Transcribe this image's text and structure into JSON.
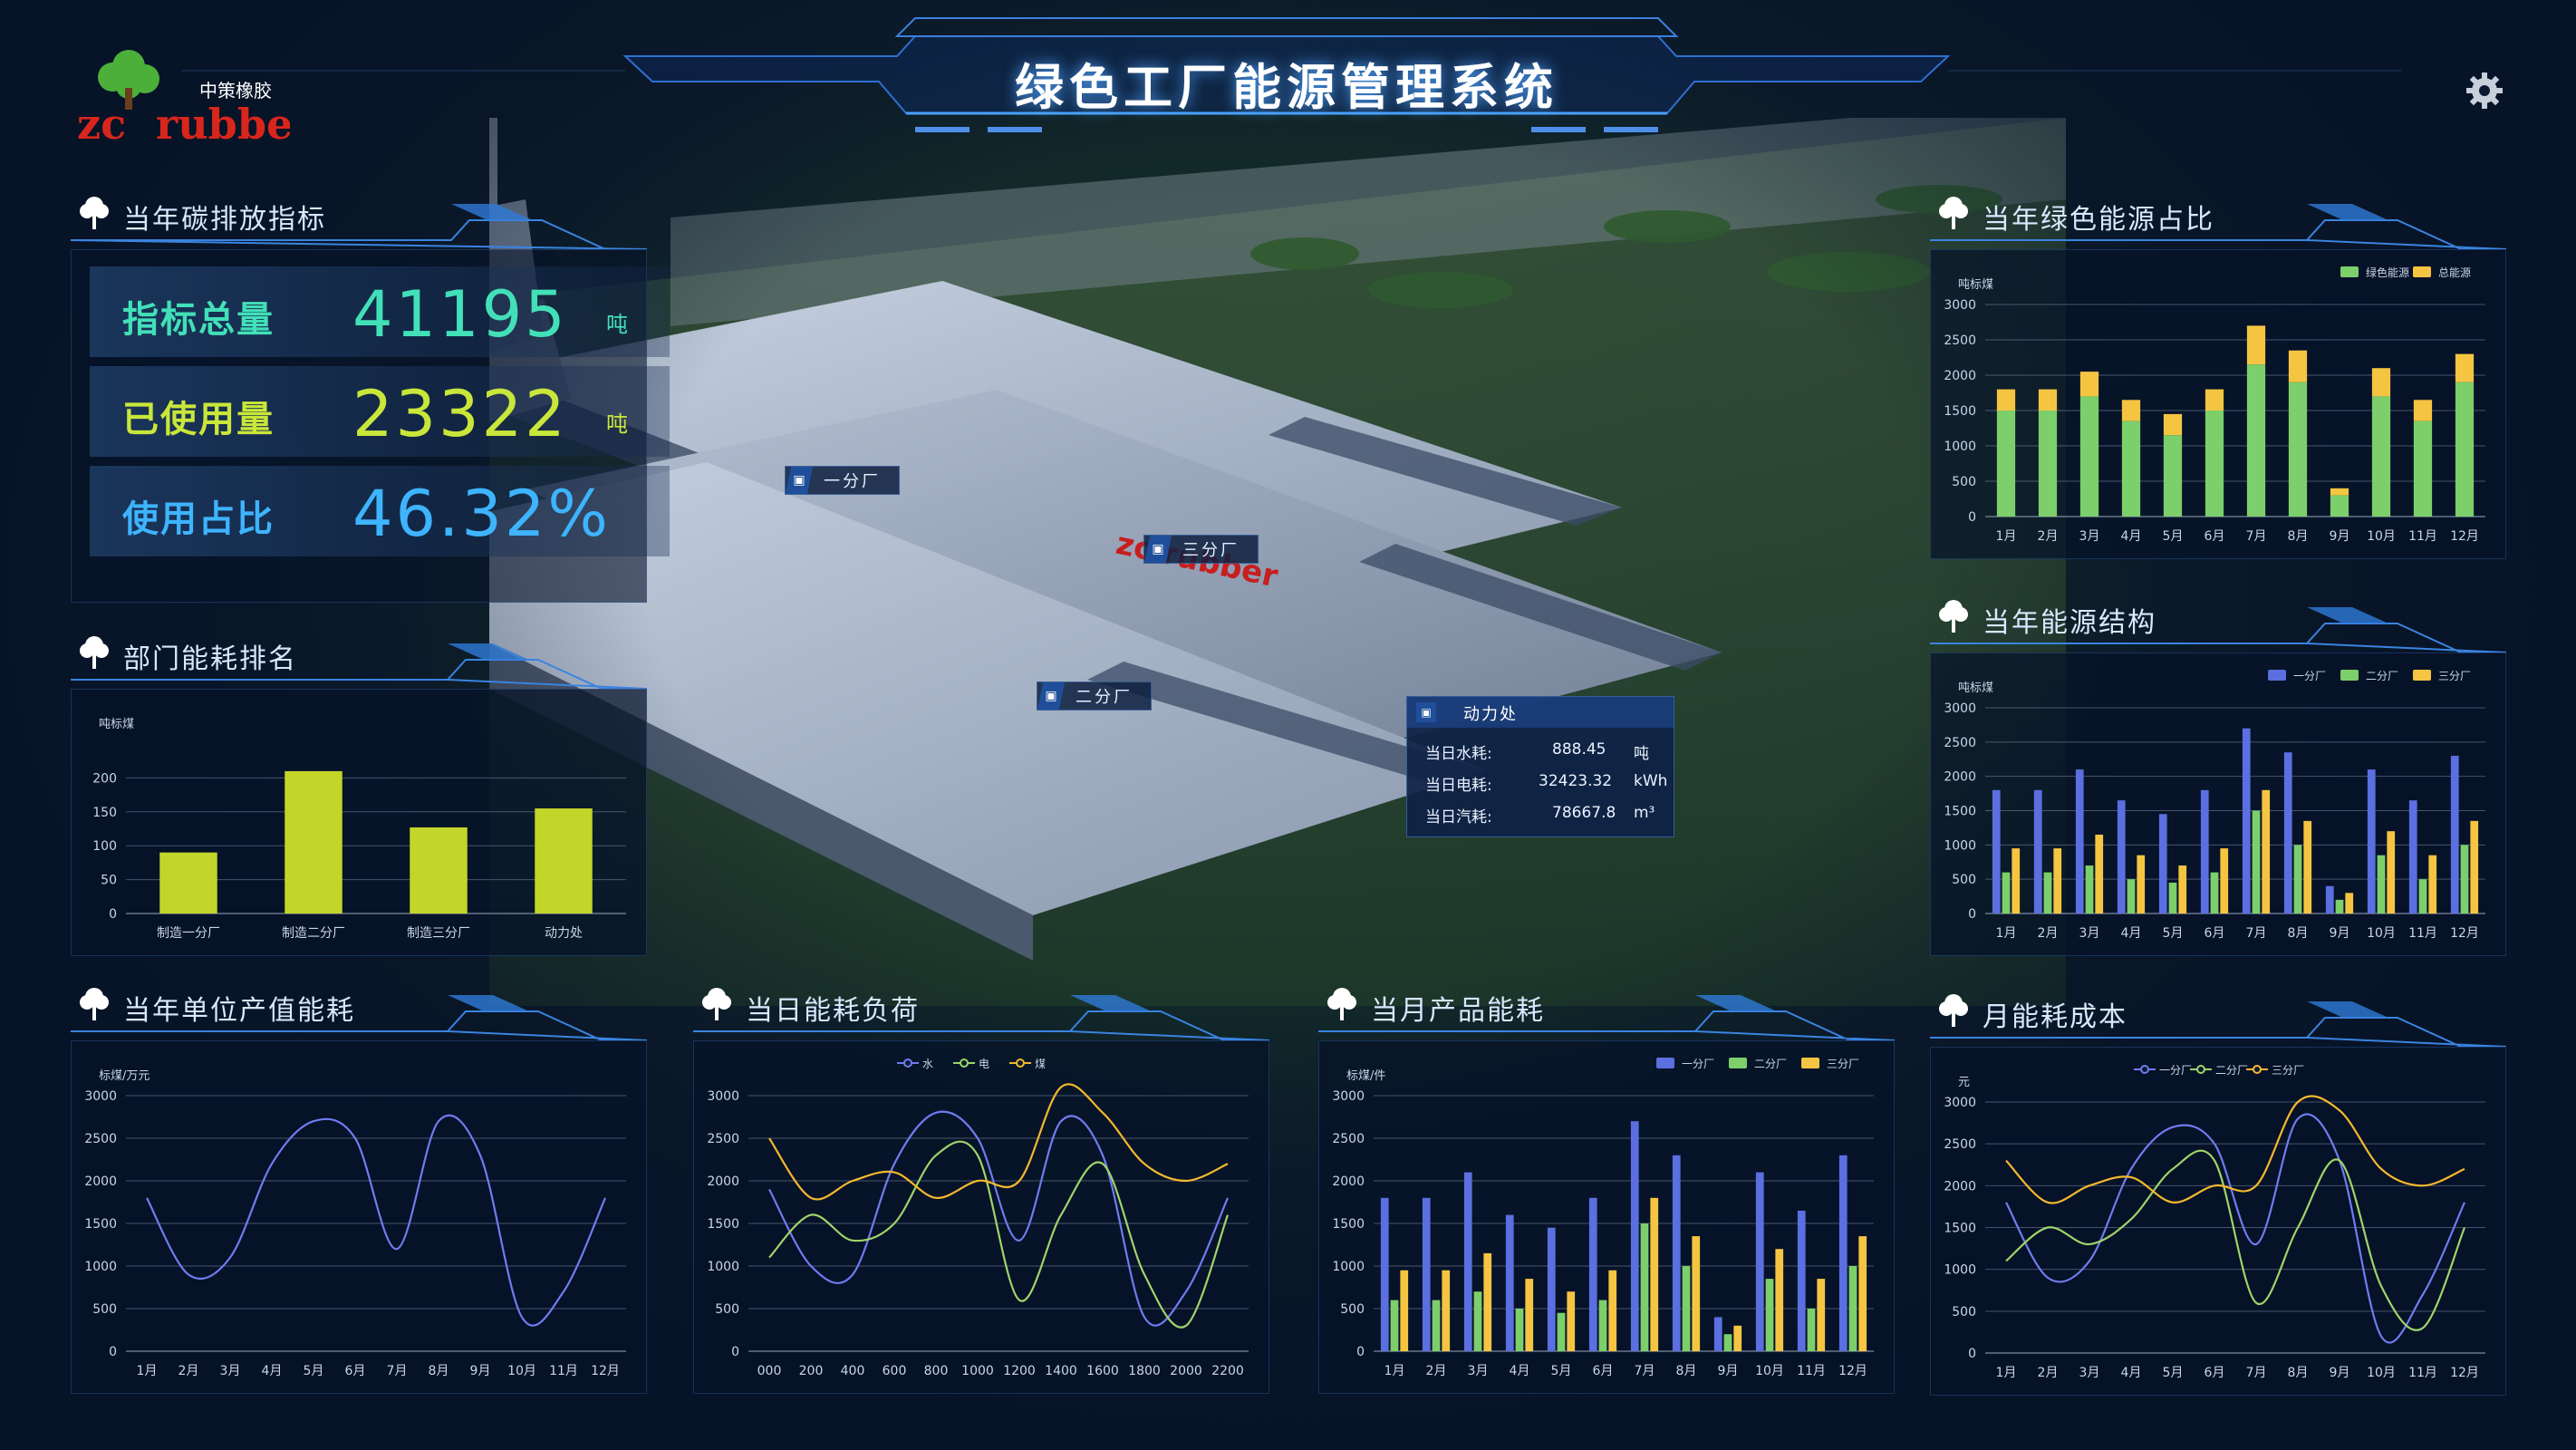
{
  "title": "绿色工厂能源管理系统",
  "logo": {
    "cn": "中策橡胶",
    "en_zc": "zc",
    "en_rubber": "rubber"
  },
  "colors": {
    "bg": "#071327",
    "green": "#7ccf6b",
    "gold": "#f5c542",
    "blue": "#5b6fe0",
    "lime": "#c2d62a"
  },
  "carbon": {
    "title": "当年碳排放指标",
    "rows": [
      {
        "label": "指标总量",
        "value": "41195",
        "unit": "吨"
      },
      {
        "label": "已使用量",
        "value": "23322",
        "unit": "吨"
      },
      {
        "label": "使用占比",
        "value": "46.32%",
        "unit": ""
      }
    ]
  },
  "buildings": [
    "一分厂",
    "三分厂",
    "二分厂"
  ],
  "power": {
    "title": "动力处",
    "rows": [
      {
        "label": "当日水耗:",
        "value": "888.45",
        "unit": "吨"
      },
      {
        "label": "当日电耗:",
        "value": "32423.32",
        "unit": "kWh"
      },
      {
        "label": "当日汽耗:",
        "value": "78667.8",
        "unit": "m³"
      }
    ]
  },
  "panels": {
    "dept": "部门能耗排名",
    "unitValue": "当年单位产值能耗",
    "dailyLoad": "当日能耗负荷",
    "monthProduct": "当月产品能耗",
    "greenRatio": "当年绿色能源占比",
    "structure": "当年能源结构",
    "cost": "月能耗成本"
  },
  "chart_data": [
    {
      "id": "dept",
      "type": "bar",
      "ylabel": "吨标煤",
      "ylim": [
        0,
        250
      ],
      "yticks": [
        0,
        50,
        100,
        150,
        200
      ],
      "categories": [
        "制造一分厂",
        "制造二分厂",
        "制造三分厂",
        "动力处"
      ],
      "series": [
        {
          "values": [
            90,
            210,
            127,
            155
          ],
          "color": "#c2d62a"
        }
      ]
    },
    {
      "id": "unitValue",
      "type": "line",
      "ylabel": "标煤/万元",
      "ylim": [
        0,
        3000
      ],
      "yticks": [
        0,
        500,
        1000,
        1500,
        2000,
        2500,
        3000
      ],
      "categories": [
        "1月",
        "2月",
        "3月",
        "4月",
        "5月",
        "6月",
        "7月",
        "8月",
        "9月",
        "10月",
        "11月",
        "12月"
      ],
      "series": [
        {
          "values": [
            1800,
            900,
            1100,
            2200,
            2700,
            2500,
            1200,
            2700,
            2300,
            400,
            700,
            1800
          ],
          "color": "#6f7cf0"
        }
      ]
    },
    {
      "id": "dailyLoad",
      "type": "line",
      "ylim": [
        0,
        3000
      ],
      "yticks": [
        0,
        500,
        1000,
        1500,
        2000,
        2500,
        3000
      ],
      "categories": [
        "000",
        "200",
        "400",
        "600",
        "800",
        "1000",
        "1200",
        "1400",
        "1600",
        "1800",
        "2000",
        "2200"
      ],
      "legend": [
        "水",
        "电",
        "煤"
      ],
      "series": [
        {
          "name": "水",
          "values": [
            1900,
            1000,
            900,
            2200,
            2800,
            2500,
            1300,
            2700,
            2300,
            400,
            700,
            1800
          ],
          "color": "#6f7cf0"
        },
        {
          "name": "电",
          "values": [
            1100,
            1600,
            1300,
            1500,
            2300,
            2300,
            600,
            1600,
            2200,
            900,
            300,
            1600
          ],
          "color": "#9fd46a"
        },
        {
          "name": "煤",
          "values": [
            2500,
            1800,
            2000,
            2100,
            1800,
            2000,
            2000,
            3100,
            2800,
            2200,
            2000,
            2200
          ],
          "color": "#f5b82e"
        }
      ]
    },
    {
      "id": "monthProduct",
      "type": "bar",
      "ylabel": "标煤/件",
      "ylim": [
        0,
        3000
      ],
      "yticks": [
        0,
        500,
        1000,
        1500,
        2000,
        2500,
        3000
      ],
      "categories": [
        "1月",
        "2月",
        "3月",
        "4月",
        "5月",
        "6月",
        "7月",
        "8月",
        "9月",
        "10月",
        "11月",
        "12月"
      ],
      "legend": [
        "一分厂",
        "二分厂",
        "三分厂"
      ],
      "series": [
        {
          "name": "一分厂",
          "values": [
            1800,
            1800,
            2100,
            1600,
            1450,
            1800,
            2700,
            2300,
            400,
            2100,
            1650,
            2300
          ],
          "color": "#5b6fe0"
        },
        {
          "name": "二分厂",
          "values": [
            600,
            600,
            700,
            500,
            450,
            600,
            1500,
            1000,
            200,
            850,
            500,
            1000
          ],
          "color": "#7ccf6b"
        },
        {
          "name": "三分厂",
          "values": [
            950,
            950,
            1150,
            850,
            700,
            950,
            1800,
            1350,
            300,
            1200,
            850,
            1350
          ],
          "color": "#f5c542"
        }
      ]
    },
    {
      "id": "greenRatio",
      "type": "bar",
      "stacked": true,
      "ylabel": "吨标煤",
      "ylim": [
        0,
        3000
      ],
      "yticks": [
        0,
        500,
        1000,
        1500,
        2000,
        2500,
        3000
      ],
      "categories": [
        "1月",
        "2月",
        "3月",
        "4月",
        "5月",
        "6月",
        "7月",
        "8月",
        "9月",
        "10月",
        "11月",
        "12月"
      ],
      "legend": [
        "绿色能源",
        "总能源"
      ],
      "series": [
        {
          "name": "绿色能源",
          "values": [
            1500,
            1500,
            1700,
            1350,
            1150,
            1500,
            2150,
            1900,
            300,
            1700,
            1350,
            1900
          ],
          "color": "#7ccf6b"
        },
        {
          "name": "总能源",
          "values": [
            1800,
            1800,
            2050,
            1650,
            1450,
            1800,
            2700,
            2350,
            400,
            2100,
            1650,
            2300
          ],
          "color": "#f5c542"
        }
      ]
    },
    {
      "id": "structure",
      "type": "bar",
      "ylabel": "吨标煤",
      "ylim": [
        0,
        3000
      ],
      "yticks": [
        0,
        500,
        1000,
        1500,
        2000,
        2500,
        3000
      ],
      "categories": [
        "1月",
        "2月",
        "3月",
        "4月",
        "5月",
        "6月",
        "7月",
        "8月",
        "9月",
        "10月",
        "11月",
        "12月"
      ],
      "legend": [
        "一分厂",
        "二分厂",
        "三分厂"
      ],
      "series": [
        {
          "name": "一分厂",
          "values": [
            1800,
            1800,
            2100,
            1650,
            1450,
            1800,
            2700,
            2350,
            400,
            2100,
            1650,
            2300
          ],
          "color": "#5b6fe0"
        },
        {
          "name": "二分厂",
          "values": [
            600,
            600,
            700,
            500,
            450,
            600,
            1500,
            1000,
            200,
            850,
            500,
            1000
          ],
          "color": "#7ccf6b"
        },
        {
          "name": "三分厂",
          "values": [
            950,
            950,
            1150,
            850,
            700,
            950,
            1800,
            1350,
            300,
            1200,
            850,
            1350
          ],
          "color": "#f5c542"
        }
      ]
    },
    {
      "id": "cost",
      "type": "line",
      "ylabel": "元",
      "ylim": [
        0,
        3000
      ],
      "yticks": [
        0,
        500,
        1000,
        1500,
        2000,
        2500,
        3000
      ],
      "categories": [
        "1月",
        "2月",
        "3月",
        "4月",
        "5月",
        "6月",
        "7月",
        "8月",
        "9月",
        "10月",
        "11月",
        "12月"
      ],
      "legend": [
        "一分厂",
        "二分厂",
        "三分厂"
      ],
      "series": [
        {
          "name": "一分厂",
          "values": [
            1800,
            900,
            1100,
            2200,
            2700,
            2500,
            1300,
            2800,
            2300,
            200,
            700,
            1800
          ],
          "color": "#6f7cf0"
        },
        {
          "name": "二分厂",
          "values": [
            1100,
            1500,
            1300,
            1600,
            2200,
            2300,
            600,
            1500,
            2300,
            800,
            300,
            1500
          ],
          "color": "#9fd46a"
        },
        {
          "name": "三分厂",
          "values": [
            2300,
            1800,
            2000,
            2100,
            1800,
            2000,
            2000,
            3000,
            2900,
            2200,
            2000,
            2200
          ],
          "color": "#f5b82e"
        }
      ]
    }
  ]
}
